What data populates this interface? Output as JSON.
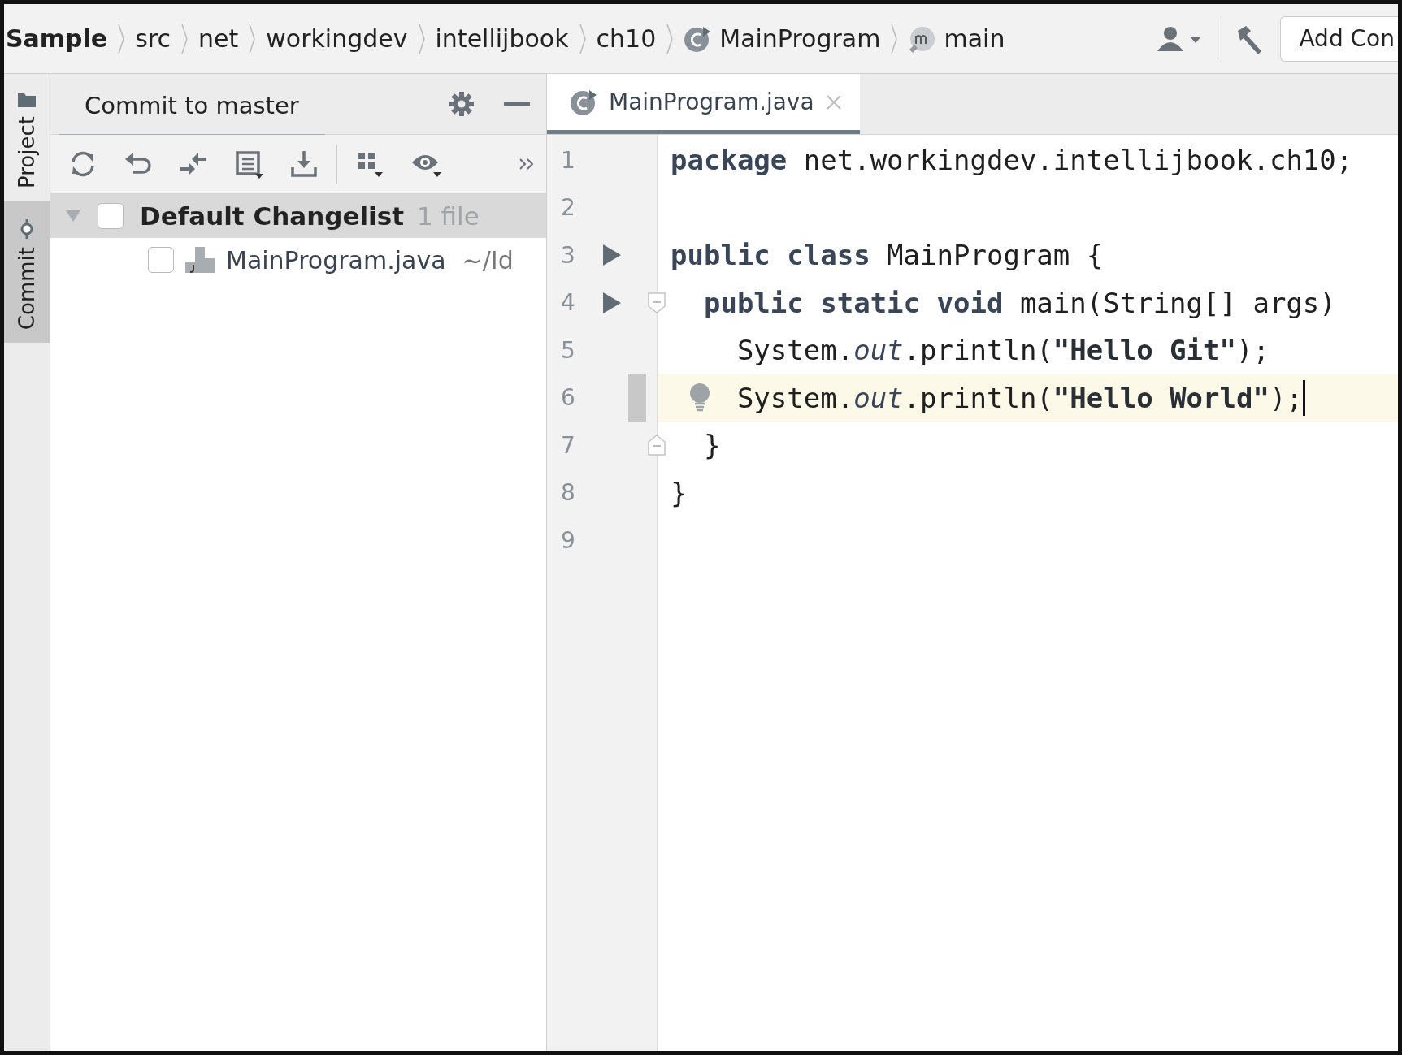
{
  "breadcrumbs": [
    {
      "label": "Sample",
      "kind": "project"
    },
    {
      "label": "src",
      "kind": "folder"
    },
    {
      "label": "net",
      "kind": "folder"
    },
    {
      "label": "workingdev",
      "kind": "folder"
    },
    {
      "label": "intellijbook",
      "kind": "folder"
    },
    {
      "label": "ch10",
      "kind": "folder"
    },
    {
      "label": "MainProgram",
      "kind": "class"
    },
    {
      "label": "main",
      "kind": "method"
    }
  ],
  "run_config_button": "Add Con",
  "side_tabs": [
    {
      "label": "Project",
      "kind": "folder",
      "selected": false
    },
    {
      "label": "Commit",
      "kind": "commit",
      "selected": true
    }
  ],
  "commit_panel": {
    "title": "Commit to master",
    "changelist": {
      "name": "Default Changelist",
      "count": "1 file",
      "expanded": true,
      "checked": false,
      "files": [
        {
          "name": "MainProgram.java",
          "path": "~/Id",
          "checked": false
        }
      ]
    }
  },
  "editor_tabs": [
    {
      "label": "MainProgram.java",
      "selected": true
    }
  ],
  "code_lines": [
    {
      "number": "1",
      "kind": "top_level",
      "run": false,
      "current": false,
      "changed": false,
      "bulb": false,
      "fold_open": false,
      "fold_close": false,
      "tokens": [
        {
          "text": "package",
          "kind": "keyword"
        },
        {
          "text": " net.workingdev.intellijbook.ch10;",
          "kind": "plain"
        }
      ]
    },
    {
      "number": "2",
      "run": false,
      "current": false,
      "changed": false,
      "bulb": false,
      "fold_open": false,
      "fold_close": false
    },
    {
      "number": "3",
      "kind": "top_level",
      "run": true,
      "current": false,
      "changed": false,
      "bulb": false,
      "fold_open": false,
      "fold_close": false,
      "tokens": [
        {
          "text": "public class",
          "kind": "keyword"
        },
        {
          "text": " MainProgram {",
          "kind": "plain"
        }
      ]
    },
    {
      "number": "4",
      "kind": "member",
      "run": true,
      "current": false,
      "changed": false,
      "bulb": false,
      "fold_open": true,
      "fold_close": false,
      "tokens": [
        {
          "text": "public static void",
          "kind": "keyword"
        },
        {
          "text": " main(String[] args)",
          "kind": "plain"
        }
      ]
    },
    {
      "number": "5",
      "kind": "statement",
      "run": false,
      "current": false,
      "changed": false,
      "bulb": false,
      "fold_open": false,
      "fold_close": false,
      "tokens": [
        {
          "text": "System.",
          "kind": "plain"
        },
        {
          "text": "out",
          "kind": "field"
        },
        {
          "text": ".println(",
          "kind": "plain"
        },
        {
          "text": "\"Hello Git\"",
          "kind": "string"
        },
        {
          "text": ");",
          "kind": "plain"
        }
      ]
    },
    {
      "number": "6",
      "kind": "statement",
      "run": false,
      "current": true,
      "changed": true,
      "bulb": true,
      "fold_open": false,
      "fold_close": false,
      "tokens": [
        {
          "text": "System.",
          "kind": "plain"
        },
        {
          "text": "out",
          "kind": "field"
        },
        {
          "text": ".println(",
          "kind": "plain"
        },
        {
          "text": "\"Hello World\"",
          "kind": "string"
        },
        {
          "text": ");",
          "kind": "plain"
        }
      ]
    },
    {
      "number": "7",
      "kind": "member",
      "run": false,
      "current": false,
      "changed": false,
      "bulb": false,
      "fold_open": false,
      "fold_close": true,
      "tokens": [
        {
          "text": "}",
          "kind": "plain"
        }
      ]
    },
    {
      "number": "8",
      "kind": "top_level",
      "run": false,
      "current": false,
      "changed": false,
      "bulb": false,
      "fold_open": false,
      "fold_close": false,
      "tokens": [
        {
          "text": "}",
          "kind": "plain"
        }
      ]
    },
    {
      "number": "9",
      "run": false,
      "current": false,
      "changed": false,
      "bulb": false,
      "fold_open": false,
      "fold_close": false
    }
  ]
}
